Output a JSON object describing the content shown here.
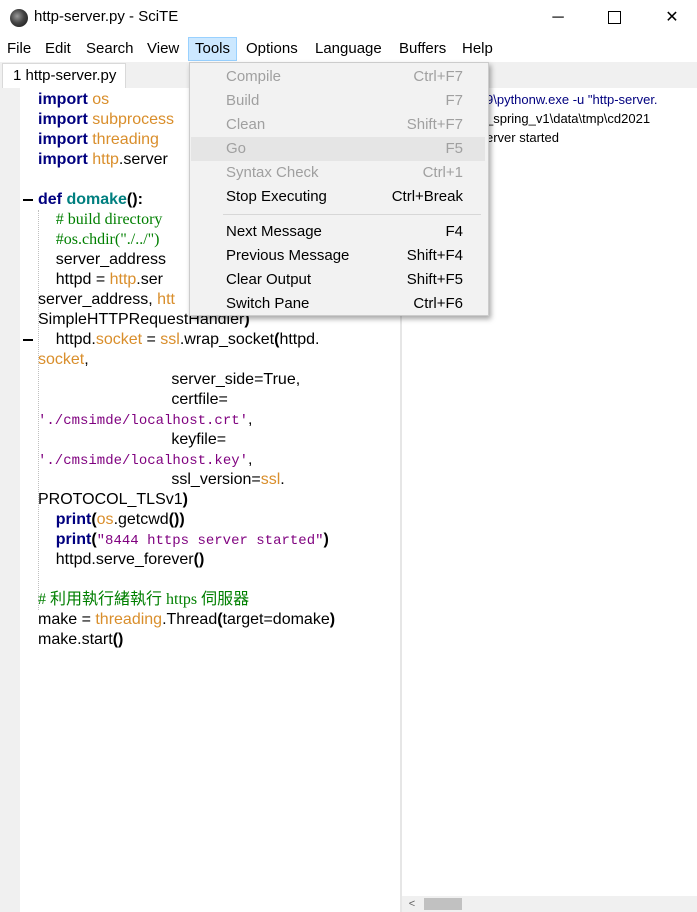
{
  "window": {
    "title": "http-server.py - SciTE",
    "min_icon": "minimize-icon",
    "max_icon": "maximize-icon",
    "close_icon": "close-icon"
  },
  "menubar": {
    "items": [
      "File",
      "Edit",
      "Search",
      "View",
      "Tools",
      "Options",
      "Language",
      "Buffers",
      "Help"
    ],
    "active": "Tools"
  },
  "tabs": [
    {
      "label": "1 http-server.py"
    }
  ],
  "editor": {
    "lines": [
      {
        "segments": [
          {
            "t": "import",
            "c": "kw"
          },
          {
            "t": " "
          },
          {
            "t": "os",
            "c": "mod"
          }
        ]
      },
      {
        "segments": [
          {
            "t": "import",
            "c": "kw"
          },
          {
            "t": " "
          },
          {
            "t": "subprocess",
            "c": "mod"
          }
        ]
      },
      {
        "segments": [
          {
            "t": "import",
            "c": "kw"
          },
          {
            "t": " "
          },
          {
            "t": "threading",
            "c": "mod"
          }
        ]
      },
      {
        "segments": [
          {
            "t": "import",
            "c": "kw"
          },
          {
            "t": " "
          },
          {
            "t": "http",
            "c": "mod"
          },
          {
            "t": ".server"
          }
        ]
      },
      {
        "segments": []
      },
      {
        "segments": [
          {
            "t": "def",
            "c": "kw"
          },
          {
            "t": " "
          },
          {
            "t": "domake",
            "c": "fn"
          },
          {
            "t": "():",
            "c": "op"
          }
        ]
      },
      {
        "segments": [
          {
            "t": "    "
          },
          {
            "t": "# build directory",
            "c": "cmt"
          }
        ]
      },
      {
        "segments": [
          {
            "t": "    "
          },
          {
            "t": "#os.chdir(\"./../\")",
            "c": "cmt"
          }
        ]
      },
      {
        "segments": [
          {
            "t": "    server_address"
          }
        ]
      },
      {
        "segments": [
          {
            "t": "    httpd = "
          },
          {
            "t": "http",
            "c": "mod"
          },
          {
            "t": ".ser"
          }
        ]
      },
      {
        "segments": [
          {
            "t": "server_address, "
          },
          {
            "t": "htt",
            "c": "mod"
          }
        ]
      },
      {
        "segments": [
          {
            "t": "SimpleHTTPRequestHandler"
          },
          {
            "t": ")",
            "c": "op"
          }
        ]
      },
      {
        "segments": [
          {
            "t": "    httpd."
          },
          {
            "t": "socket",
            "c": "mod"
          },
          {
            "t": " = "
          },
          {
            "t": "ssl",
            "c": "mod"
          },
          {
            "t": ".wrap_socket"
          },
          {
            "t": "(",
            "c": "op"
          },
          {
            "t": "httpd."
          }
        ]
      },
      {
        "segments": [
          {
            "t": "socket",
            "c": "mod"
          },
          {
            "t": ","
          }
        ]
      },
      {
        "segments": [
          {
            "t": "                              server_side=True,"
          }
        ]
      },
      {
        "segments": [
          {
            "t": "                              certfile="
          }
        ]
      },
      {
        "segments": [
          {
            "t": "'./cmsimde/localhost.crt'",
            "c": "str"
          },
          {
            "t": ","
          }
        ]
      },
      {
        "segments": [
          {
            "t": "                              keyfile="
          }
        ]
      },
      {
        "segments": [
          {
            "t": "'./cmsimde/localhost.key'",
            "c": "str"
          },
          {
            "t": ","
          }
        ]
      },
      {
        "segments": [
          {
            "t": "                              ssl_version="
          },
          {
            "t": "ssl",
            "c": "mod"
          },
          {
            "t": "."
          }
        ]
      },
      {
        "segments": [
          {
            "t": "PROTOCOL_TLSv1"
          },
          {
            "t": ")",
            "c": "op"
          }
        ]
      },
      {
        "segments": [
          {
            "t": "    "
          },
          {
            "t": "print",
            "c": "kw"
          },
          {
            "t": "(",
            "c": "op"
          },
          {
            "t": "os",
            "c": "mod"
          },
          {
            "t": ".getcwd"
          },
          {
            "t": "())",
            "c": "op"
          }
        ]
      },
      {
        "segments": [
          {
            "t": "    "
          },
          {
            "t": "print",
            "c": "kw"
          },
          {
            "t": "(",
            "c": "op"
          },
          {
            "t": "\"8444 https server started\"",
            "c": "str"
          },
          {
            "t": ")",
            "c": "op"
          }
        ]
      },
      {
        "segments": [
          {
            "t": "    httpd.serve_forever"
          },
          {
            "t": "()",
            "c": "op"
          }
        ]
      },
      {
        "segments": []
      },
      {
        "segments": [
          {
            "t": "# 利用執行緒執行 https 伺服器",
            "c": "cmt"
          }
        ]
      },
      {
        "segments": [
          {
            "t": "make = "
          },
          {
            "t": "threading",
            "c": "mod"
          },
          {
            "t": ".Thread"
          },
          {
            "t": "(",
            "c": "op"
          },
          {
            "t": "target=domake"
          },
          {
            "t": ")",
            "c": "op"
          }
        ]
      },
      {
        "segments": [
          {
            "t": "make.start"
          },
          {
            "t": "()",
            "c": "op"
          }
        ]
      }
    ]
  },
  "output": {
    "lines": [
      {
        "text": "9\\pythonw.exe -u \"http-server.",
        "cls": "out-cmd"
      },
      {
        "text": "_spring_v1\\data\\tmp\\cd2021",
        "cls": ""
      },
      {
        "text": "erver started",
        "cls": ""
      }
    ]
  },
  "tools_menu": {
    "items": [
      {
        "label": "Compile",
        "shortcut": "Ctrl+F7",
        "enabled": false
      },
      {
        "label": "Build",
        "shortcut": "F7",
        "enabled": false
      },
      {
        "label": "Clean",
        "shortcut": "Shift+F7",
        "enabled": false
      },
      {
        "label": "Go",
        "shortcut": "F5",
        "enabled": false,
        "hover": true
      },
      {
        "label": "Syntax Check",
        "shortcut": "Ctrl+1",
        "enabled": false
      },
      {
        "label": "Stop Executing",
        "shortcut": "Ctrl+Break",
        "enabled": true
      },
      {
        "separator": true
      },
      {
        "label": "Next Message",
        "shortcut": "F4",
        "enabled": true
      },
      {
        "label": "Previous Message",
        "shortcut": "Shift+F4",
        "enabled": true
      },
      {
        "label": "Clear Output",
        "shortcut": "Shift+F5",
        "enabled": true
      },
      {
        "label": "Switch Pane",
        "shortcut": "Ctrl+F6",
        "enabled": true
      }
    ]
  },
  "scrollbar": {
    "left_arrow_icon": "scroll-left-icon"
  }
}
